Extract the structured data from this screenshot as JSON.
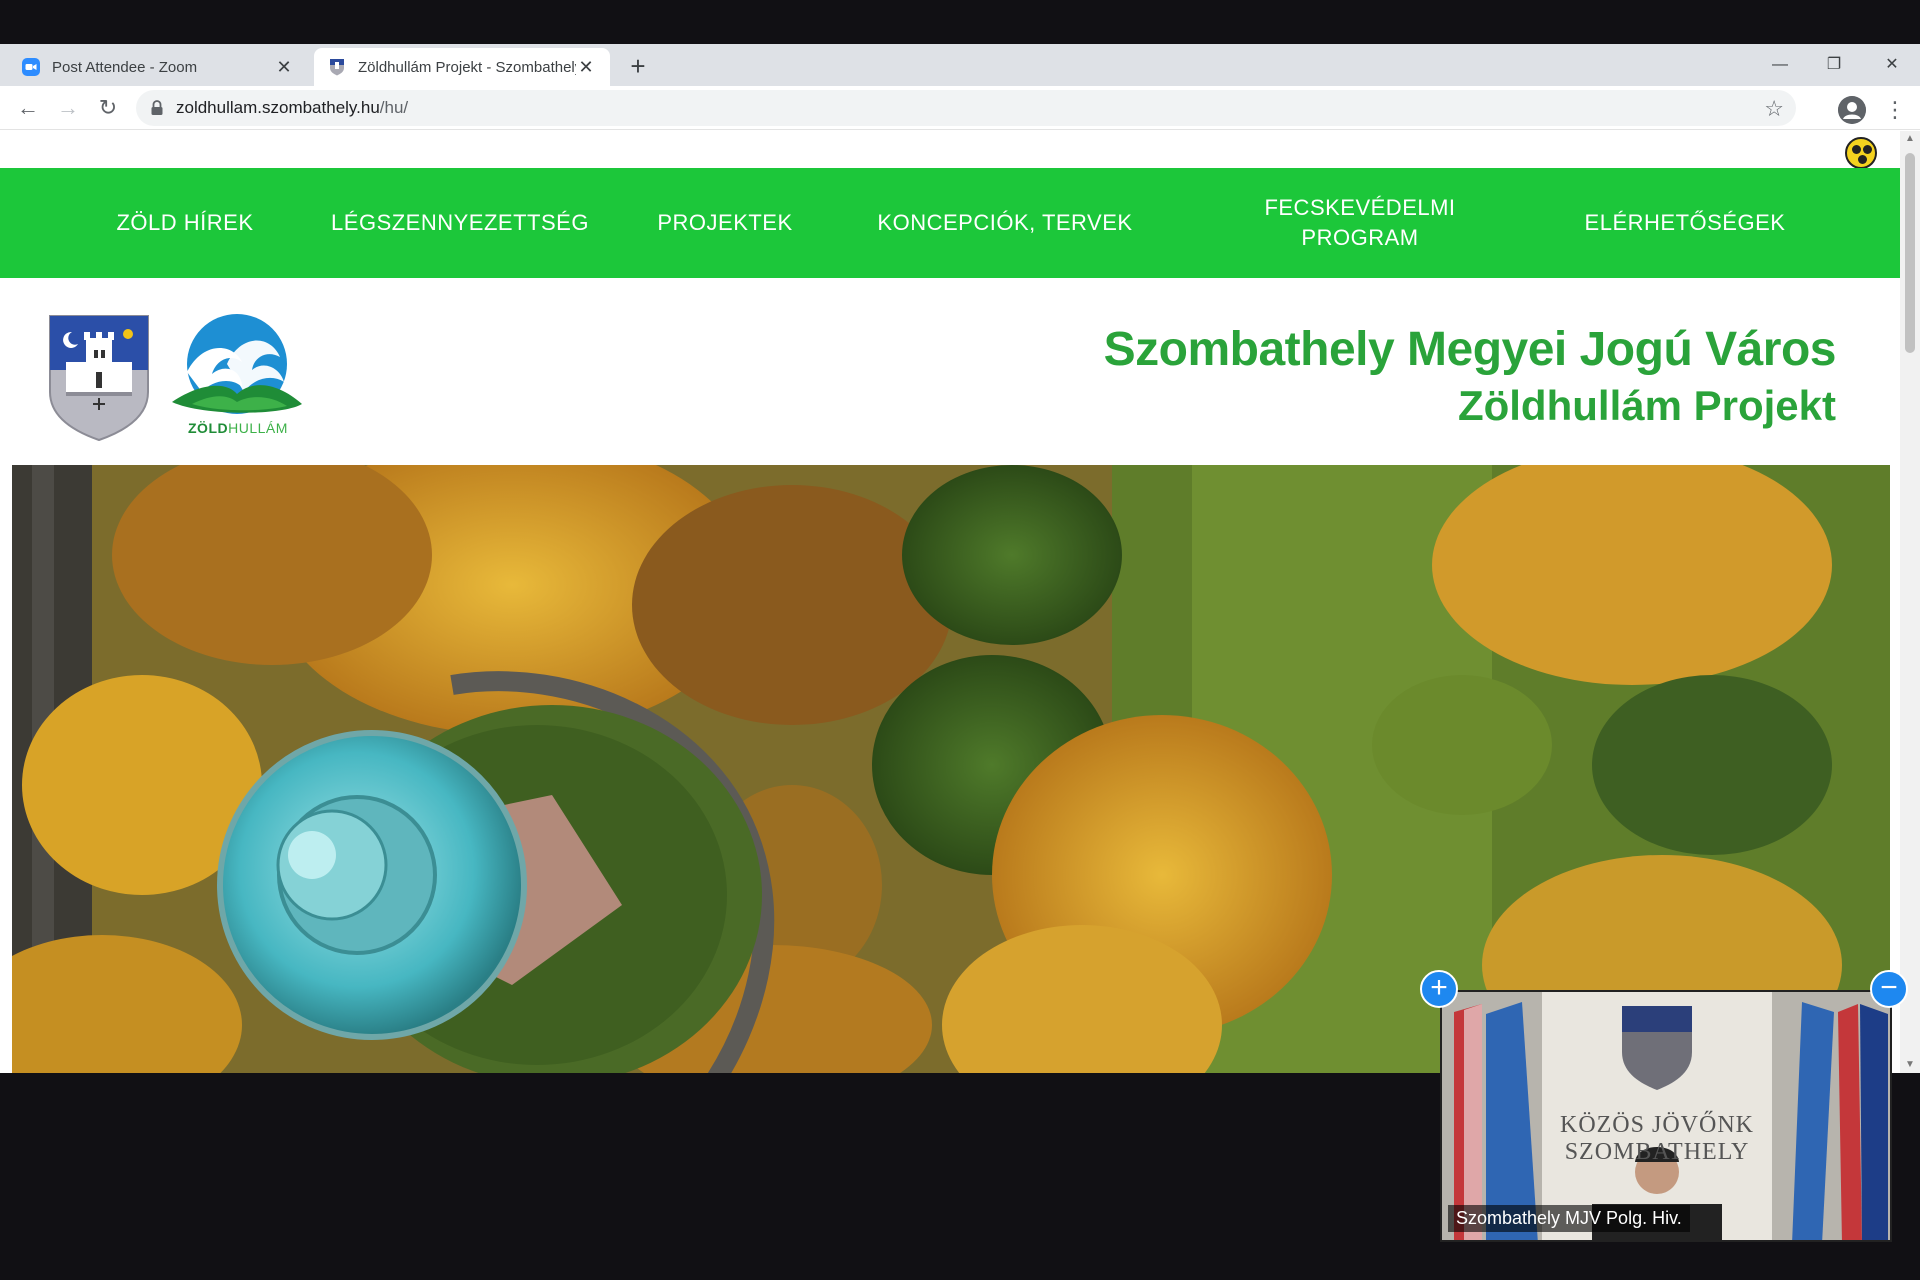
{
  "browser": {
    "tabs": [
      {
        "title": "Post Attendee - Zoom",
        "active": false
      },
      {
        "title": "Zöldhullám Projekt - Szombathely",
        "active": true
      }
    ],
    "url": {
      "host": "zoldhullam.szombathely.hu",
      "path": "/hu/"
    }
  },
  "nav": {
    "items": [
      "ZÖLD HÍREK",
      "LÉGSZENNYEZETTSÉG",
      "PROJEKTEK",
      "KONCEPCIÓK, TERVEK",
      "FECSKEVÉDELMI PROGRAM",
      "ELÉRHETŐSÉGEK"
    ]
  },
  "header": {
    "title": "Szombathely Megyei Jogú Város",
    "subtitle": "Zöldhullám Projekt",
    "logo_text_bold": "ZÖLD",
    "logo_text_light": "HULLÁM"
  },
  "video": {
    "participant_name": "Szombathely MJV Polg. Hiv.",
    "banner_line1": "KÖZÖS JÖVŐNK",
    "banner_line2": "SZOMBATHELY"
  },
  "colors": {
    "nav_green": "#1cc73a",
    "title_green": "#2aa33a",
    "zoom_blue": "#1e88f0"
  }
}
